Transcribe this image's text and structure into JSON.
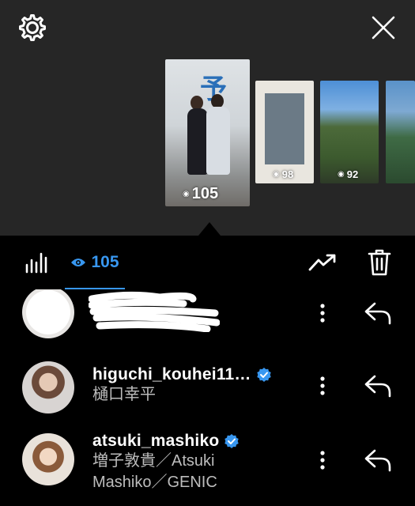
{
  "header": {
    "settings_icon": "gear-icon",
    "close_icon": "close-icon"
  },
  "stories": [
    {
      "views": "105",
      "selected": true
    },
    {
      "views": "98",
      "selected": false
    },
    {
      "views": "92",
      "selected": false
    },
    {
      "views": "",
      "selected": false
    }
  ],
  "toolbar": {
    "stats_icon": "bar-chart-icon",
    "viewers_icon": "eye-icon",
    "viewer_count": "105",
    "insights_icon": "trending-up-icon",
    "delete_icon": "trash-icon"
  },
  "viewers": [
    {
      "username": "",
      "fullname": "",
      "verified": false,
      "redacted": true
    },
    {
      "username": "higuchi_kouhei11…",
      "fullname": "樋口幸平",
      "verified": true
    },
    {
      "username": "atsuki_mashiko",
      "fullname_line1": "増子敦貴／Atsuki",
      "fullname_line2": "Mashiko／GENIC",
      "verified": true
    }
  ],
  "colors": {
    "accent": "#3897f0",
    "top_background": "#262626",
    "list_background": "#000000",
    "verified_badge": "#3897f0"
  }
}
